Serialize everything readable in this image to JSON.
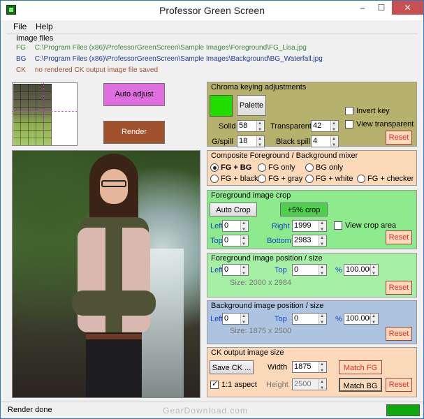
{
  "window": {
    "title": "Professor Green Screen",
    "min": "–",
    "max": "☐",
    "close": "✕"
  },
  "menu": {
    "file": "File",
    "help": "Help"
  },
  "image_files": {
    "legend": "Image files",
    "fg": {
      "tag": "FG",
      "path": "C:\\Program Files (x86)\\ProfessorGreenScreen\\Sample Images\\Foreground\\FG_Lisa.jpg",
      "color": "#3a8a3a"
    },
    "bg": {
      "tag": "BG",
      "path": "C:\\Program Files (x86)\\ProfessorGreenScreen\\Sample Images\\Background\\BG_Waterfall.jpg",
      "color": "#1a3a9a"
    },
    "ck": {
      "tag": "CK",
      "path": "no rendered CK output image file saved",
      "color": "#a0522d"
    }
  },
  "actions": {
    "auto_adjust": "Auto adjust",
    "render": "Render"
  },
  "chroma": {
    "title": "Chroma keying adjustments",
    "key_color": "#22dd00",
    "palette": "Palette",
    "solid_label": "Solid",
    "solid": "58",
    "transparent_label": "Transparent",
    "transparent": "42",
    "gspill_label": "G/spill",
    "gspill": "18",
    "black_spill_label": "Black spill",
    "black_spill": "4",
    "invert_key": "Invert key",
    "view_transparent": "View transparent",
    "reset": "Reset"
  },
  "composite": {
    "title": "Composite Foreground / Background mixer",
    "options": [
      "FG + BG",
      "FG only",
      "BG only",
      "FG + black",
      "FG + gray",
      "FG + white",
      "FG + checker"
    ],
    "selected": "FG + BG"
  },
  "fg_crop": {
    "title": "Foreground image crop",
    "auto_crop": "Auto Crop",
    "plus5": "+5% crop",
    "view_crop_area": "View crop area",
    "left_label": "Left",
    "left": "0",
    "right_label": "Right",
    "right": "1999",
    "top_label": "Top",
    "top": "0",
    "bottom_label": "Bottom",
    "bottom": "2983",
    "reset": "Reset"
  },
  "fg_pos": {
    "title": "Foreground image position / size",
    "left_label": "Left",
    "left": "0",
    "top_label": "Top",
    "top": "0",
    "pct_label": "%",
    "pct": "100.000",
    "size": "Size: 2000 x 2984",
    "reset": "Reset"
  },
  "bg_pos": {
    "title": "Background image position / size",
    "left_label": "Left",
    "left": "0",
    "top_label": "Top",
    "top": "0",
    "pct_label": "%",
    "pct": "100.000",
    "size": "Size: 1875 x 2500",
    "reset": "Reset"
  },
  "ck_out": {
    "title": "CK output image size",
    "save": "Save CK ...",
    "width_label": "Width",
    "width": "1875",
    "height_label": "Height",
    "height": "2500",
    "aspect": "1:1 aspect",
    "match_fg": "Match FG",
    "match_bg": "Match BG",
    "reset": "Reset"
  },
  "status": {
    "text": "Render done",
    "watermark": "GearDownload.com",
    "light_color": "#0fa80f"
  }
}
